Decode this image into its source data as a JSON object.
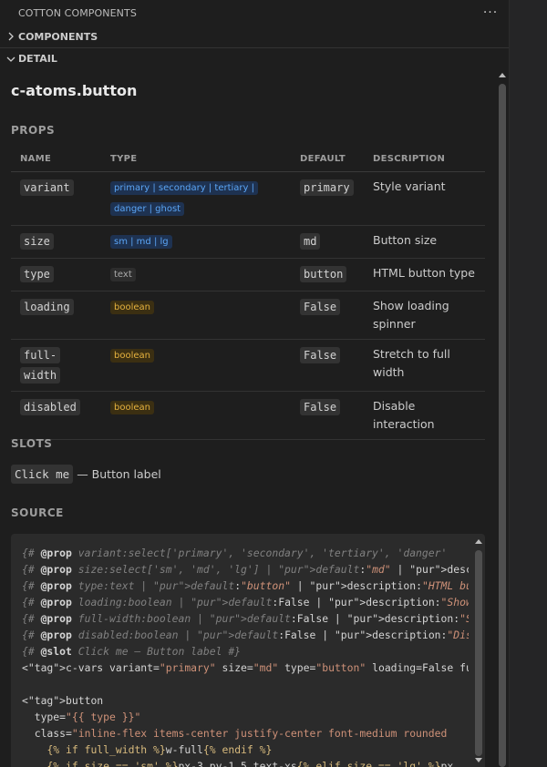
{
  "panel": {
    "title": "COTTON COMPONENTS",
    "more_label": "···"
  },
  "sections": {
    "components": "COMPONENTS",
    "detail": "DETAIL"
  },
  "detail": {
    "component_name": "c-atoms.button",
    "props_heading": "PROPS",
    "slots_heading": "SLOTS",
    "source_heading": "SOURCE",
    "columns": [
      "NAME",
      "TYPE",
      "DEFAULT",
      "DESCRIPTION"
    ],
    "props": [
      {
        "name": "variant",
        "type": "primary | secondary | tertiary | danger | ghost",
        "type_color": "blue",
        "default": "primary",
        "description": "Style variant"
      },
      {
        "name": "size",
        "type": "sm | md | lg",
        "type_color": "blue",
        "default": "md",
        "description": "Button size"
      },
      {
        "name": "type",
        "type": "text",
        "type_color": "gray",
        "default": "button",
        "description": "HTML button type"
      },
      {
        "name": "loading",
        "type": "boolean",
        "type_color": "yellow",
        "default": "False",
        "description": "Show loading spinner"
      },
      {
        "name": "full-width",
        "type": "boolean",
        "type_color": "yellow",
        "default": "False",
        "description": "Stretch to full width"
      },
      {
        "name": "disabled",
        "type": "boolean",
        "type_color": "yellow",
        "default": "False",
        "description": "Disable interaction"
      }
    ],
    "slot": {
      "name": "Click me",
      "description": "— Button label"
    },
    "source_lines": [
      "{# @prop variant:select['primary', 'secondary', 'tertiary', 'danger'",
      "{# @prop size:select['sm', 'md', 'lg'] | default:\"md\" | description:",
      "{# @prop type:text | default:\"button\" | description:\"HTML button type",
      "{# @prop loading:boolean | default:False | description:\"Show loading",
      "{# @prop full-width:boolean | default:False | description:\"Stretch to",
      "{# @prop disabled:boolean | default:False | description:\"Disable inte",
      "{# @slot Click me — Button label #}",
      "<c-vars variant=\"primary\" size=\"md\" type=\"button\" loading=False full",
      "",
      "<button",
      "  type=\"{{ type }}\"",
      "  class=\"inline-flex items-center justify-center font-medium rounded",
      "    {% if full_width %}w-full{% endif %}",
      "    {% if size == 'sm' %}px-3 py-1.5 text-xs{% elif size == 'lg' %}px"
    ]
  },
  "colors": {
    "background": "#1e1e1e",
    "code_background": "#2b2b2b",
    "chip_blue": "#5ba5f5",
    "chip_yellow": "#e6b23e",
    "html_tag": "#e06c75",
    "string": "#ce9178"
  }
}
